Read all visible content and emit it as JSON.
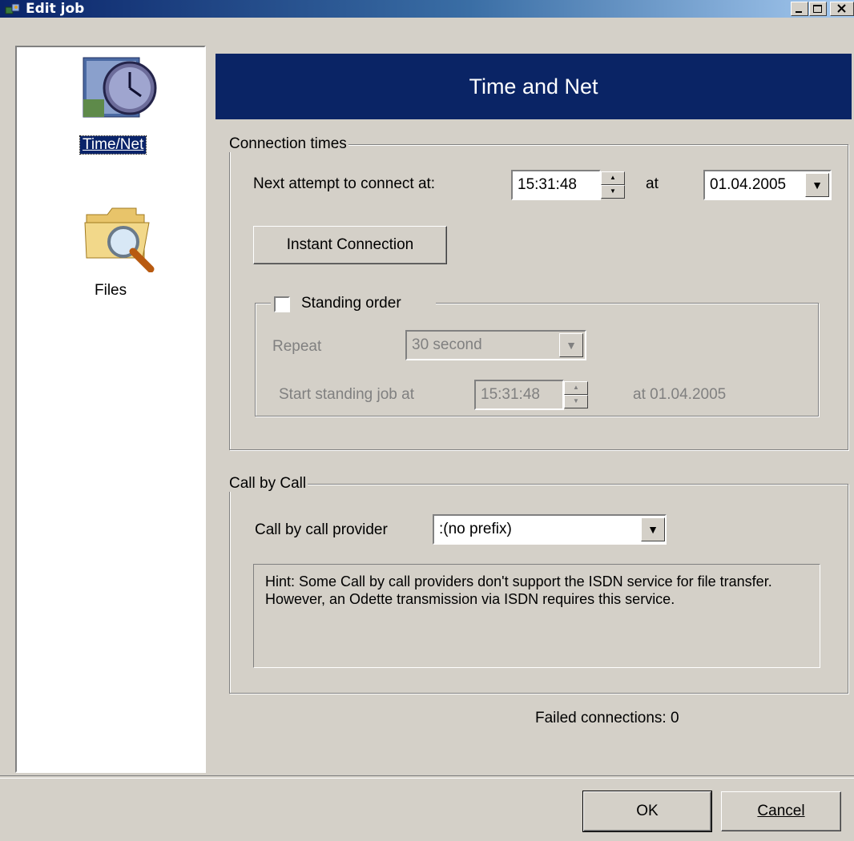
{
  "window": {
    "title": "Edit job",
    "controls": {
      "minimize": "_",
      "maximize": "□",
      "close": "×"
    }
  },
  "sidebar": {
    "items": [
      {
        "label": "Time/Net",
        "icon": "clock-icon",
        "selected": true
      },
      {
        "label": "Files",
        "icon": "folder-search-icon",
        "selected": false
      }
    ]
  },
  "header": {
    "title": "Time and Net"
  },
  "connection_times": {
    "legend": "Connection times",
    "next_attempt_label": "Next attempt to connect at:",
    "time_value": "15:31:48",
    "at_label": "at",
    "date_value": "01.04.2005",
    "instant_button": "Instant Connection"
  },
  "standing_order": {
    "legend": "Standing order",
    "checked": false,
    "repeat_label": "Repeat",
    "repeat_value": "30 second",
    "start_label": "Start standing job at",
    "start_time": "15:31:48",
    "start_date_text": "at 01.04.2005"
  },
  "call_by_call": {
    "legend": "Call by Call",
    "provider_label": "Call by call provider",
    "provider_value": ":(no prefix)",
    "hint": "Hint: Some Call by call providers don't support the ISDN service for file transfer. However, an Odette transmission via ISDN requires this service."
  },
  "status": {
    "failed_connections": "Failed connections: 0"
  },
  "buttons": {
    "ok": "OK",
    "cancel": "Cancel"
  },
  "colors": {
    "title_start": "#0a246a",
    "header_bg": "#0a2465",
    "face": "#d4d0c8",
    "selection": "#0a246a"
  }
}
